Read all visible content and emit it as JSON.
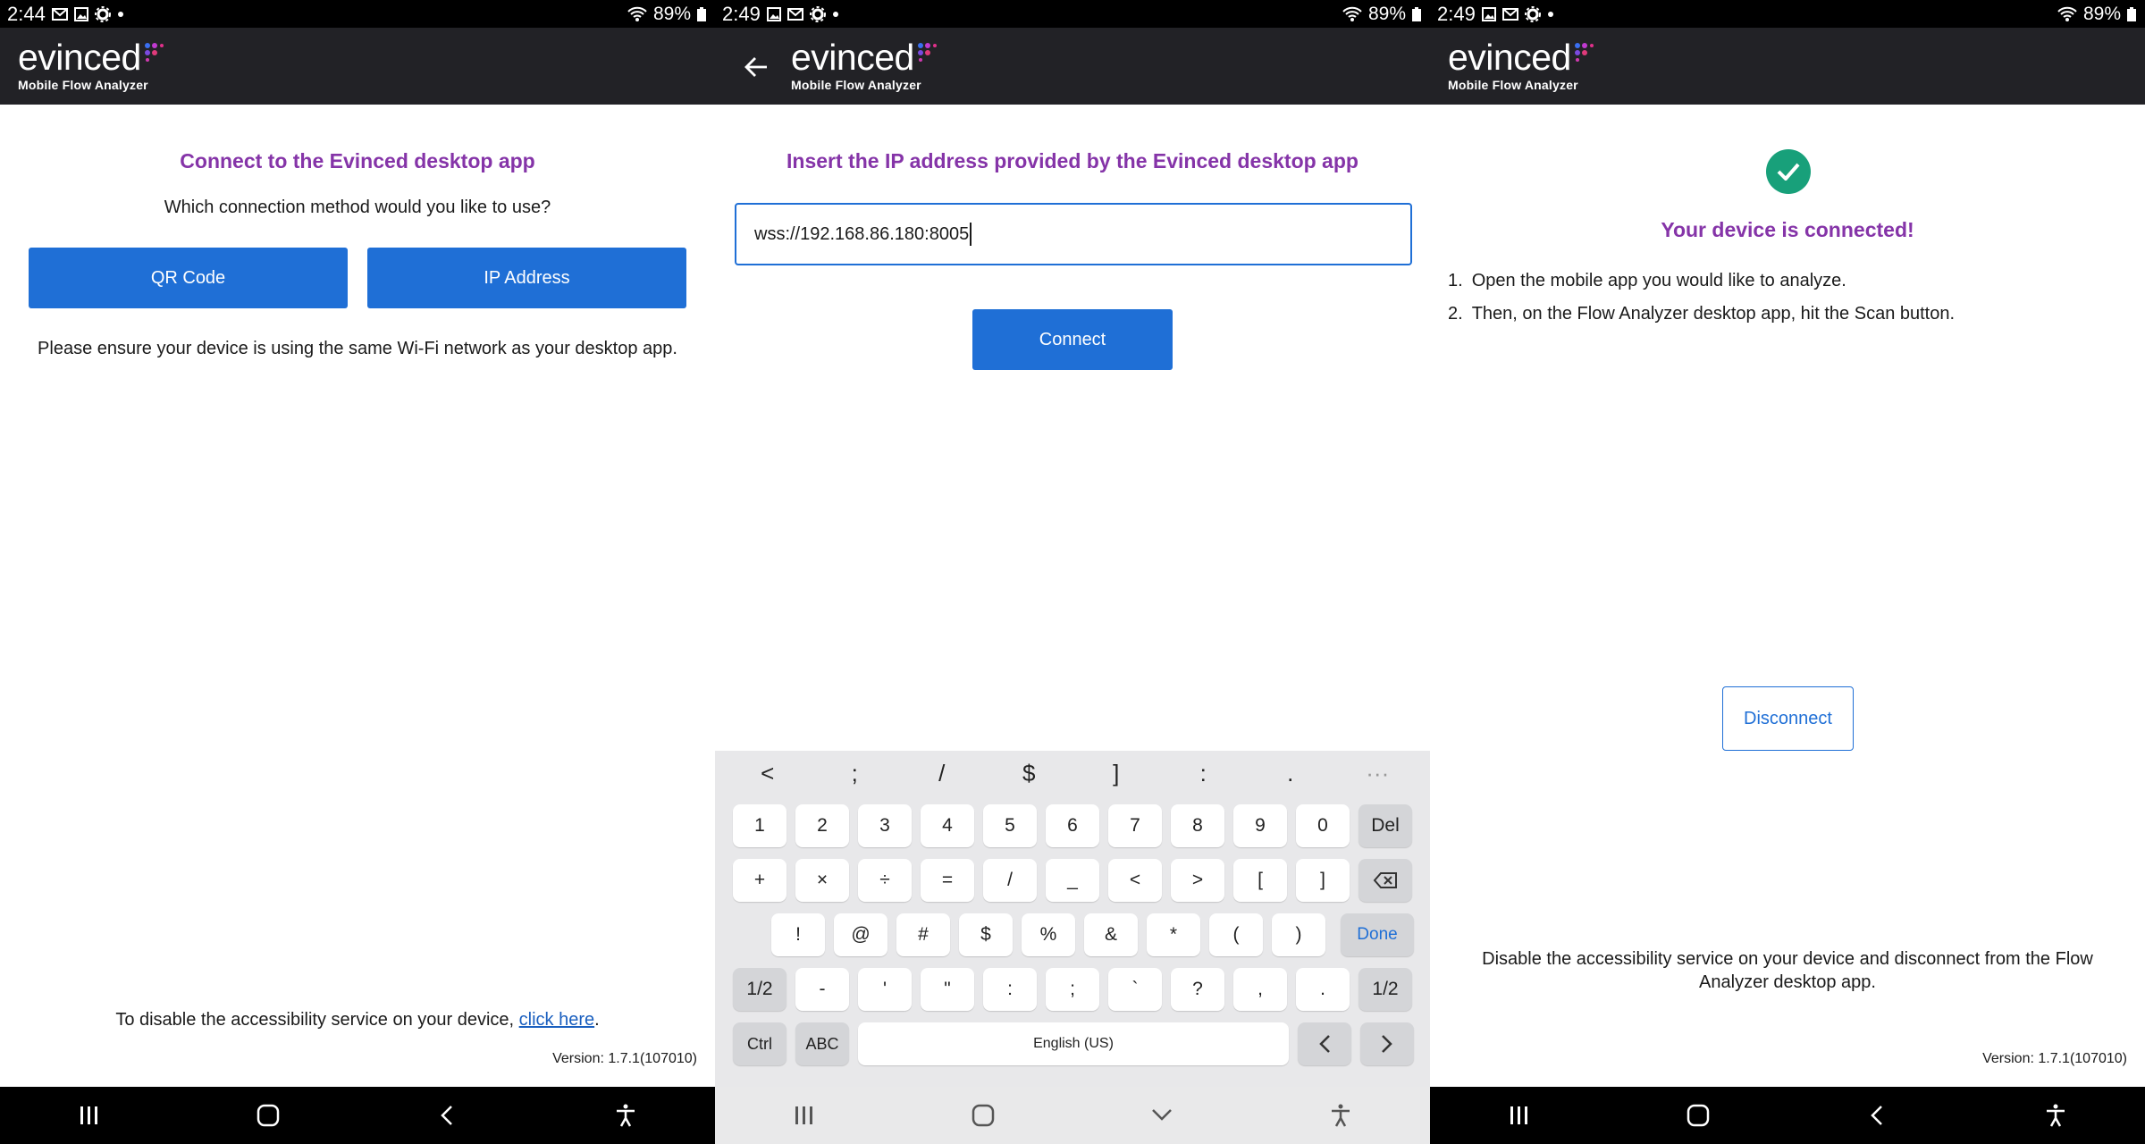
{
  "colors": {
    "accent_blue": "#1f6fd6",
    "title_purple": "#8534a8",
    "header_bg": "#222226",
    "success_green": "#18a07a"
  },
  "screens": [
    {
      "status": {
        "time": "2:44",
        "battery": "89%",
        "icons": [
          "gmail-icon",
          "image-icon",
          "settings-icon",
          "dot-icon"
        ]
      },
      "logo": {
        "word": "evinced",
        "sub": "Mobile Flow Analyzer"
      },
      "title": "Connect to the Evinced desktop app",
      "question": "Which connection method would you like to use?",
      "buttons": {
        "qr": "QR Code",
        "ip": "IP Address"
      },
      "note": "Please ensure your device is using the same Wi-Fi network as your desktop app.",
      "footer": {
        "prefix": "To disable the accessibility service on your device, ",
        "link": "click here",
        "suffix": "."
      },
      "version": "Version: 1.7.1(107010)"
    },
    {
      "status": {
        "time": "2:49",
        "battery": "89%",
        "icons": [
          "image-icon",
          "gmail-icon",
          "settings-icon",
          "dot-icon"
        ]
      },
      "logo": {
        "word": "evinced",
        "sub": "Mobile Flow Analyzer"
      },
      "title": "Insert the IP address provided by the Evinced desktop app",
      "input_value": "wss://192.168.86.180:8005",
      "connect_label": "Connect",
      "keyboard": {
        "top_symbols": [
          "<",
          ";",
          "/",
          "$",
          "]",
          ":",
          ".",
          "···"
        ],
        "row1": [
          "1",
          "2",
          "3",
          "4",
          "5",
          "6",
          "7",
          "8",
          "9",
          "0",
          "Del"
        ],
        "row2": [
          "+",
          "×",
          "÷",
          "=",
          "/",
          "_",
          "<",
          ">",
          "[",
          "]"
        ],
        "row3": [
          "!",
          "@",
          "#",
          "$",
          "%",
          "&",
          "*",
          "(",
          ")",
          "Done"
        ],
        "row4": [
          "1/2",
          "-",
          "'",
          "\"",
          ":",
          ";",
          "`",
          "?",
          ",",
          ".",
          "1/2"
        ],
        "row5": {
          "ctrl": "Ctrl",
          "abc": "ABC",
          "space": "English (US)"
        }
      }
    },
    {
      "status": {
        "time": "2:49",
        "battery": "89%",
        "icons": [
          "image-icon",
          "gmail-icon",
          "settings-icon",
          "dot-icon"
        ]
      },
      "logo": {
        "word": "evinced",
        "sub": "Mobile Flow Analyzer"
      },
      "title": "Your device is connected!",
      "steps": [
        {
          "num": "1.",
          "text": "Open the mobile app you would like to analyze."
        },
        {
          "num": "2.",
          "text": "Then, on the Flow Analyzer desktop app, hit the Scan button."
        }
      ],
      "disconnect_label": "Disconnect",
      "disable_note": "Disable the accessibility service on your device and disconnect from the Flow Analyzer desktop app.",
      "version": "Version: 1.7.1(107010)"
    }
  ]
}
